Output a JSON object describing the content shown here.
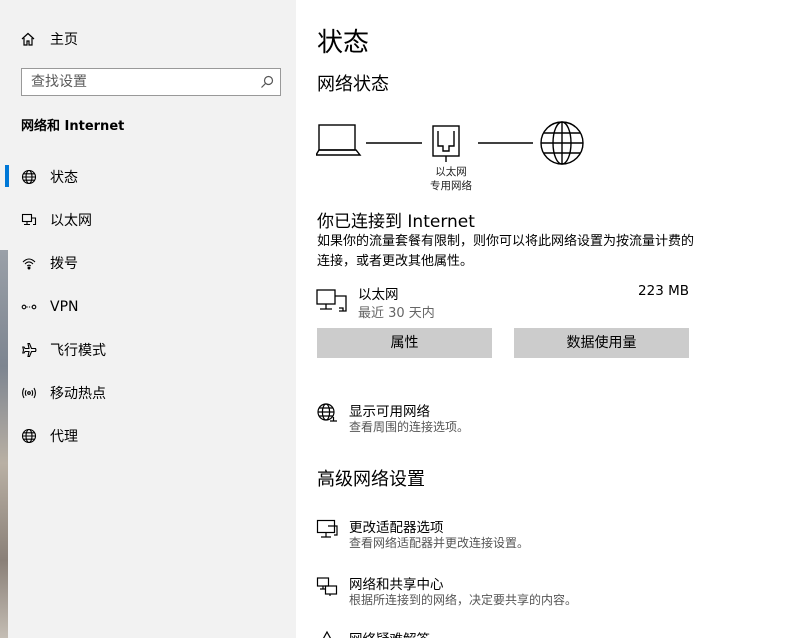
{
  "sidebar": {
    "home_label": "主页",
    "search_placeholder": "查找设置",
    "section_title": "网络和 Internet",
    "items": [
      {
        "label": "状态",
        "icon": "globe-icon",
        "active": true
      },
      {
        "label": "以太网",
        "icon": "ethernet-icon"
      },
      {
        "label": "拨号",
        "icon": "dialup-icon"
      },
      {
        "label": "VPN",
        "icon": "vpn-icon"
      },
      {
        "label": "飞行模式",
        "icon": "airplane-icon"
      },
      {
        "label": "移动热点",
        "icon": "hotspot-icon"
      },
      {
        "label": "代理",
        "icon": "globe-icon"
      }
    ]
  },
  "main": {
    "title": "状态",
    "network_status_title": "网络状态",
    "diagram_label_line1": "以太网",
    "diagram_label_line2": "专用网络",
    "connected_title": "你已连接到 Internet",
    "connected_desc": "如果你的流量套餐有限制，则你可以将此网络设置为按流量计费的连接，或者更改其他属性。",
    "ethernet": {
      "name": "以太网",
      "sub": "最近 30 天内",
      "usage": "223 MB"
    },
    "buttons": {
      "properties": "属性",
      "data_usage": "数据使用量"
    },
    "show_networks": {
      "title": "显示可用网络",
      "sub": "查看周围的连接选项。"
    },
    "advanced_title": "高级网络设置",
    "adapter_options": {
      "title": "更改适配器选项",
      "sub": "查看网络适配器并更改连接设置。"
    },
    "sharing_center": {
      "title": "网络和共享中心",
      "sub": "根据所连接到的网络，决定要共享的内容。"
    },
    "troubleshooter": {
      "title": "网络疑难解答"
    }
  },
  "colors": {
    "accent": "#0078d7",
    "sidebar_bg": "#f2f2f2",
    "button_bg": "#cccccc"
  }
}
